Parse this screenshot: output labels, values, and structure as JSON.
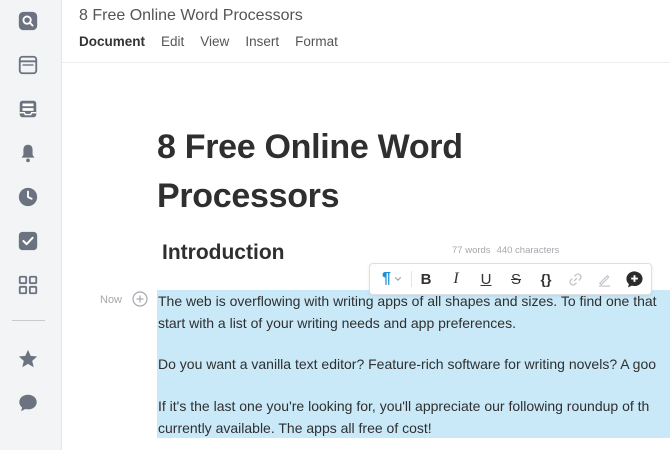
{
  "document": {
    "title": "8 Free Online Word Processors",
    "heading": "8 Free Online Word Processors",
    "section_heading": "Introduction",
    "stats": {
      "words": "77 words",
      "characters": "440 characters"
    },
    "timestamp": "Now",
    "paragraphs": {
      "p1_line1": "The web is overflowing with writing apps of all shapes and sizes. To find one that",
      "p1_line2": "start with a list of your writing needs and app preferences.",
      "p2_line1": "Do you want a vanilla text editor? Feature-rich software for writing novels? A goo",
      "p3_line1": "If it's the last one you're looking for, you'll appreciate our following roundup of th",
      "p3_line2": "currently available. The apps all free of cost!"
    }
  },
  "menu": {
    "items": [
      "Document",
      "Edit",
      "View",
      "Insert",
      "Format"
    ]
  },
  "toolbar": {
    "paragraph_glyph": "¶",
    "bold": "B",
    "italic": "I",
    "underline": "U",
    "strike": "S",
    "code": "{}"
  },
  "sidebar_icons": [
    "search-icon",
    "browser-icon",
    "inbox-icon",
    "bell-icon",
    "clock-icon",
    "checkbox-icon",
    "grid-icon",
    "star-icon",
    "chat-icon"
  ],
  "colors": {
    "accent": "#1a8fd6",
    "selection": "#c9e9f8",
    "rail_icon": "#6b7280"
  }
}
